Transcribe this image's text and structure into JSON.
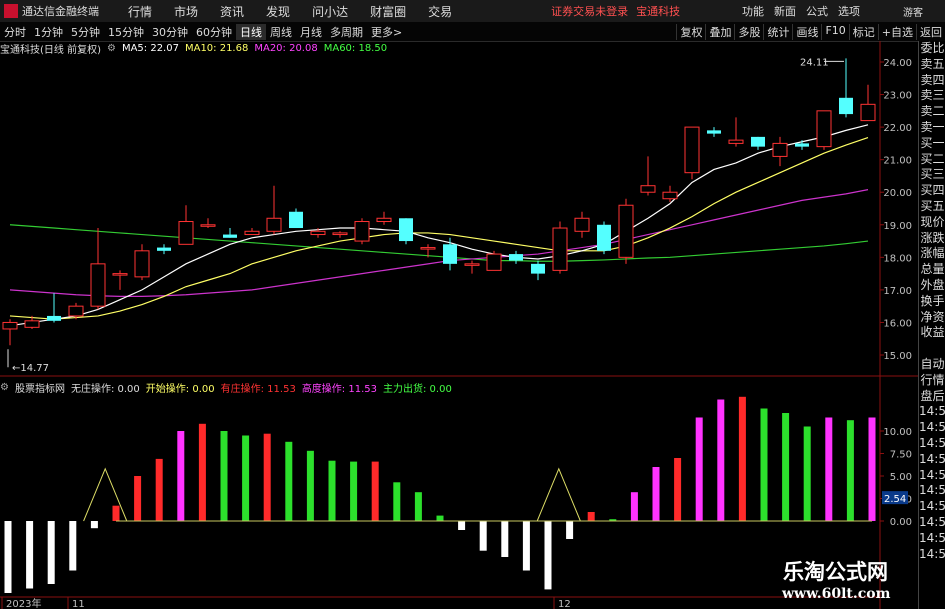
{
  "app": {
    "name": "通达信金融终端",
    "menu": [
      "行情",
      "市场",
      "资讯",
      "发现",
      "问小达",
      "财富圈",
      "交易"
    ],
    "notice": "证券交易未登录",
    "notice_stock": "宝通科技",
    "right_menu": [
      "功能",
      "新面",
      "公式",
      "选项"
    ],
    "guest": "游客"
  },
  "toolbar": {
    "periods": [
      "分时",
      "1分钟",
      "5分钟",
      "15分钟",
      "30分钟",
      "60分钟",
      "日线",
      "周线",
      "月线",
      "多周期",
      "更多>"
    ],
    "active_period": "日线",
    "tools": [
      "复权",
      "叠加",
      "多股",
      "统计",
      "画线",
      "F10",
      "标记",
      "+自选",
      "返回"
    ]
  },
  "ma_legend": {
    "title": "宝通科技(日线 前复权)",
    "items": [
      {
        "label": "MA5: 22.07",
        "color": "#ffffff"
      },
      {
        "label": "MA10: 21.68",
        "color": "#ffff66"
      },
      {
        "label": "MA20: 20.08",
        "color": "#ff44ff"
      },
      {
        "label": "MA60: 18.50",
        "color": "#44ff44"
      }
    ]
  },
  "ind_legend": {
    "title": "股票指标网",
    "items": [
      {
        "label": "无庄操作: 0.00",
        "color": "#dddddd"
      },
      {
        "label": "开始操作: 0.00",
        "color": "#ffff66"
      },
      {
        "label": "有庄操作: 11.53",
        "color": "#ff3333"
      },
      {
        "label": "高度操作: 11.53",
        "color": "#ff44ff"
      },
      {
        "label": "主力出货: 0.00",
        "color": "#44ff44"
      }
    ]
  },
  "price_axis": [
    "24.00",
    "23.00",
    "22.00",
    "21.00",
    "20.00",
    "19.00",
    "18.00",
    "17.00",
    "16.00",
    "15.00"
  ],
  "ind_axis": [
    "10.00",
    "7.50",
    "5.00",
    "2.50",
    "0.00"
  ],
  "ind_current": "2.54",
  "annotations": {
    "high": "24.11",
    "low": "14.77"
  },
  "dates": [
    "2023年",
    "11",
    "12"
  ],
  "side_panel": [
    "委比",
    "卖五",
    "卖四",
    "卖三",
    "卖二",
    "卖一",
    "买一",
    "买二",
    "买三",
    "买四",
    "买五",
    "现价",
    "涨跌",
    "涨幅",
    "总量",
    "外盘",
    "换手",
    "净资",
    "收益",
    "",
    "自动",
    "行情",
    "盘后",
    "14:50",
    "14:50",
    "14:50",
    "14:50",
    "14:50",
    "14:50",
    "14:50",
    "14:50",
    "14:50",
    "14:50"
  ],
  "watermark": {
    "title": "乐淘公式网",
    "url": "www.60lt.com"
  },
  "colors": {
    "up": "#ff3333",
    "down": "#54ffff",
    "ma5": "#ffffff",
    "ma10": "#ffff66",
    "ma20": "#cc33cc",
    "ma60": "#33cc33"
  },
  "chart_data": {
    "type": "candlestick",
    "candles": [
      {
        "o": 15.8,
        "c": 16.0,
        "h": 16.1,
        "l": 15.3
      },
      {
        "o": 15.85,
        "c": 16.05,
        "h": 16.2,
        "l": 15.8
      },
      {
        "o": 16.2,
        "c": 16.05,
        "h": 16.9,
        "l": 16.0
      },
      {
        "o": 16.2,
        "c": 16.5,
        "h": 16.6,
        "l": 16.1
      },
      {
        "o": 16.5,
        "c": 17.8,
        "h": 18.9,
        "l": 16.4
      },
      {
        "o": 17.5,
        "c": 17.5,
        "h": 17.6,
        "l": 17.0
      },
      {
        "o": 17.4,
        "c": 18.2,
        "h": 18.4,
        "l": 17.3
      },
      {
        "o": 18.3,
        "c": 18.2,
        "h": 18.4,
        "l": 18.1
      },
      {
        "o": 18.4,
        "c": 19.1,
        "h": 19.6,
        "l": 18.4
      },
      {
        "o": 19.0,
        "c": 19.0,
        "h": 19.2,
        "l": 18.9
      },
      {
        "o": 18.7,
        "c": 18.6,
        "h": 18.9,
        "l": 18.6
      },
      {
        "o": 18.7,
        "c": 18.8,
        "h": 18.9,
        "l": 18.7
      },
      {
        "o": 18.8,
        "c": 19.2,
        "h": 20.2,
        "l": 18.7
      },
      {
        "o": 19.4,
        "c": 18.9,
        "h": 19.5,
        "l": 18.9
      },
      {
        "o": 18.7,
        "c": 18.8,
        "h": 18.9,
        "l": 18.6
      },
      {
        "o": 18.7,
        "c": 18.75,
        "h": 18.8,
        "l": 18.6
      },
      {
        "o": 18.5,
        "c": 19.1,
        "h": 19.2,
        "l": 18.4
      },
      {
        "o": 19.1,
        "c": 19.2,
        "h": 19.4,
        "l": 19.0
      },
      {
        "o": 19.2,
        "c": 18.5,
        "h": 19.2,
        "l": 18.4
      },
      {
        "o": 18.3,
        "c": 18.3,
        "h": 18.4,
        "l": 18.0
      },
      {
        "o": 18.4,
        "c": 17.8,
        "h": 18.6,
        "l": 17.6
      },
      {
        "o": 17.8,
        "c": 17.8,
        "h": 17.9,
        "l": 17.5
      },
      {
        "o": 17.6,
        "c": 18.1,
        "h": 18.2,
        "l": 17.6
      },
      {
        "o": 18.1,
        "c": 17.9,
        "h": 18.2,
        "l": 17.8
      },
      {
        "o": 17.8,
        "c": 17.5,
        "h": 17.9,
        "l": 17.3
      },
      {
        "o": 17.6,
        "c": 18.9,
        "h": 19.1,
        "l": 17.5
      },
      {
        "o": 18.8,
        "c": 19.2,
        "h": 19.4,
        "l": 18.6
      },
      {
        "o": 19.0,
        "c": 18.2,
        "h": 19.1,
        "l": 18.1
      },
      {
        "o": 18.0,
        "c": 19.6,
        "h": 19.8,
        "l": 17.8
      },
      {
        "o": 20.0,
        "c": 20.2,
        "h": 21.1,
        "l": 19.9
      },
      {
        "o": 19.8,
        "c": 20.0,
        "h": 20.2,
        "l": 19.7
      },
      {
        "o": 20.6,
        "c": 22.0,
        "h": 22.0,
        "l": 20.4
      },
      {
        "o": 21.9,
        "c": 21.8,
        "h": 22.0,
        "l": 21.7
      },
      {
        "o": 21.5,
        "c": 21.6,
        "h": 22.3,
        "l": 21.4
      },
      {
        "o": 21.7,
        "c": 21.4,
        "h": 21.7,
        "l": 21.3
      },
      {
        "o": 21.1,
        "c": 21.5,
        "h": 21.7,
        "l": 20.8
      },
      {
        "o": 21.5,
        "c": 21.4,
        "h": 21.6,
        "l": 21.3
      },
      {
        "o": 21.4,
        "c": 22.5,
        "h": 22.5,
        "l": 21.3
      },
      {
        "o": 22.9,
        "c": 22.4,
        "h": 24.11,
        "l": 22.3
      },
      {
        "o": 22.2,
        "c": 22.7,
        "h": 23.3,
        "l": 22.2
      }
    ],
    "ma5": [
      15.9,
      16.0,
      16.1,
      16.2,
      16.4,
      16.7,
      17.0,
      17.4,
      17.8,
      18.1,
      18.4,
      18.6,
      18.7,
      18.8,
      18.85,
      18.9,
      18.9,
      18.85,
      18.8,
      18.6,
      18.45,
      18.25,
      18.1,
      18.0,
      17.95,
      18.05,
      18.2,
      18.4,
      18.8,
      19.2,
      19.65,
      20.3,
      20.7,
      20.9,
      21.2,
      21.4,
      21.55,
      21.7,
      21.9,
      22.07
    ],
    "ma10": [
      16.2,
      16.15,
      16.1,
      16.15,
      16.2,
      16.35,
      16.55,
      16.8,
      17.1,
      17.3,
      17.5,
      17.8,
      18.0,
      18.2,
      18.35,
      18.5,
      18.6,
      18.7,
      18.75,
      18.75,
      18.7,
      18.6,
      18.5,
      18.4,
      18.3,
      18.2,
      18.2,
      18.2,
      18.35,
      18.6,
      18.9,
      19.25,
      19.65,
      20.0,
      20.3,
      20.6,
      20.9,
      21.2,
      21.45,
      21.68
    ],
    "ma20": [
      17.0,
      16.95,
      16.9,
      16.85,
      16.82,
      16.8,
      16.8,
      16.82,
      16.85,
      16.9,
      16.95,
      17.0,
      17.1,
      17.2,
      17.3,
      17.4,
      17.5,
      17.6,
      17.7,
      17.8,
      17.9,
      17.95,
      18.0,
      18.05,
      18.1,
      18.2,
      18.3,
      18.4,
      18.55,
      18.7,
      18.85,
      19.0,
      19.15,
      19.3,
      19.45,
      19.6,
      19.75,
      19.85,
      19.95,
      20.08
    ],
    "ma60": [
      19.0,
      18.95,
      18.9,
      18.85,
      18.8,
      18.75,
      18.7,
      18.65,
      18.6,
      18.55,
      18.5,
      18.45,
      18.4,
      18.35,
      18.3,
      18.25,
      18.2,
      18.15,
      18.1,
      18.05,
      18.0,
      17.95,
      17.9,
      17.9,
      17.88,
      17.88,
      17.9,
      17.92,
      17.95,
      17.98,
      18.0,
      18.05,
      18.1,
      18.15,
      18.2,
      18.25,
      18.3,
      18.35,
      18.42,
      18.5
    ],
    "indicator": [
      {
        "v": -8.0,
        "t": "white"
      },
      {
        "v": -7.5,
        "t": "white"
      },
      {
        "v": -7.0,
        "t": "white"
      },
      {
        "v": -5.5,
        "t": "white"
      },
      {
        "v": -0.8,
        "t": "white"
      },
      {
        "v": 1.7,
        "t": "red"
      },
      {
        "v": 5.0,
        "t": "red"
      },
      {
        "v": 6.9,
        "t": "red"
      },
      {
        "v": 10.0,
        "t": "magenta"
      },
      {
        "v": 10.8,
        "t": "red"
      },
      {
        "v": 10.0,
        "t": "green"
      },
      {
        "v": 9.5,
        "t": "green"
      },
      {
        "v": 9.7,
        "t": "red"
      },
      {
        "v": 8.8,
        "t": "green"
      },
      {
        "v": 7.8,
        "t": "green"
      },
      {
        "v": 6.7,
        "t": "green"
      },
      {
        "v": 6.6,
        "t": "green"
      },
      {
        "v": 6.6,
        "t": "red"
      },
      {
        "v": 4.3,
        "t": "green"
      },
      {
        "v": 3.2,
        "t": "green"
      },
      {
        "v": 0.6,
        "t": "green"
      },
      {
        "v": -1.0,
        "t": "white"
      },
      {
        "v": -3.3,
        "t": "white"
      },
      {
        "v": -4.0,
        "t": "white"
      },
      {
        "v": -5.5,
        "t": "white"
      },
      {
        "v": -7.6,
        "t": "white"
      },
      {
        "v": -2.0,
        "t": "white"
      },
      {
        "v": 1.0,
        "t": "red"
      },
      {
        "v": 0.2,
        "t": "green"
      },
      {
        "v": 3.2,
        "t": "magenta"
      },
      {
        "v": 6.0,
        "t": "magenta"
      },
      {
        "v": 7.0,
        "t": "red"
      },
      {
        "v": 11.5,
        "t": "magenta"
      },
      {
        "v": 13.5,
        "t": "magenta"
      },
      {
        "v": 13.8,
        "t": "red"
      },
      {
        "v": 12.5,
        "t": "green"
      },
      {
        "v": 12.0,
        "t": "green"
      },
      {
        "v": 10.5,
        "t": "green"
      },
      {
        "v": 11.5,
        "t": "magenta"
      },
      {
        "v": 11.2,
        "t": "green"
      },
      {
        "v": 11.5,
        "t": "magenta"
      }
    ],
    "peaks": [
      {
        "i": 4.5,
        "v": 5.8
      },
      {
        "i": 25.5,
        "v": 5.8
      }
    ]
  }
}
